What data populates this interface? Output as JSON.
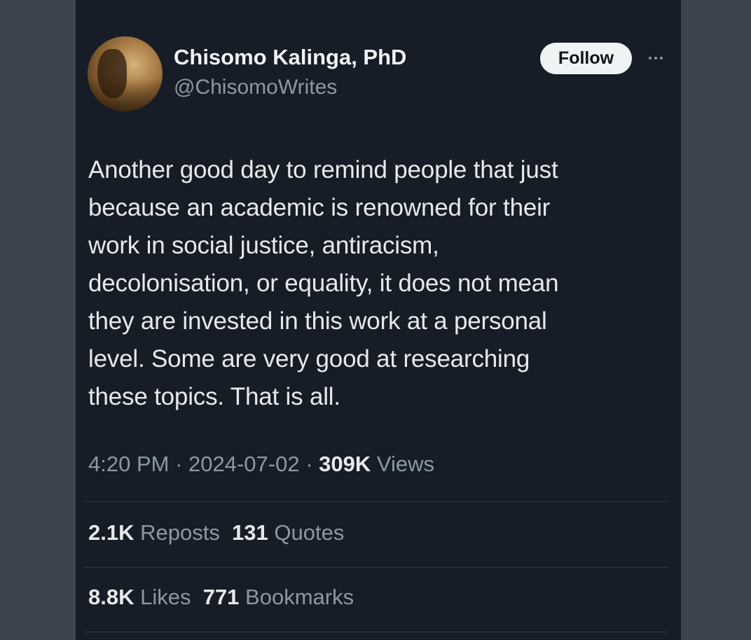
{
  "author": {
    "display_name": "Chisomo Kalinga, PhD",
    "handle": "@ChisomoWrites"
  },
  "follow_label": "Follow",
  "more_icon": "ellipsis-icon",
  "tweet": {
    "text": "Another good day to remind people that just\nbecause an academic is renowned for their\nwork in social justice, antiracism,\ndecolonisation, or equality, it does not mean\nthey are invested in this work at a personal\nlevel. Some are very good at researching\nthese topics. That is all."
  },
  "meta": {
    "time": "4:20 PM",
    "sep1": " · ",
    "date": "2024-07-02",
    "sep2": " · ",
    "views_count": "309K",
    "views_label": " Views"
  },
  "stats": {
    "reposts_count": "2.1K",
    "reposts_label": " Reposts",
    "quotes_count": "131",
    "quotes_label": " Quotes",
    "likes_count": "8.8K",
    "likes_label": " Likes",
    "bookmarks_count": "771",
    "bookmarks_label": " Bookmarks"
  },
  "colors": {
    "page_bg": "#3e4350",
    "card_bg": "#171d26",
    "primary_text": "#e7e9ea",
    "secondary_text": "#8b98a5",
    "follow_bg": "#eff3f4"
  }
}
